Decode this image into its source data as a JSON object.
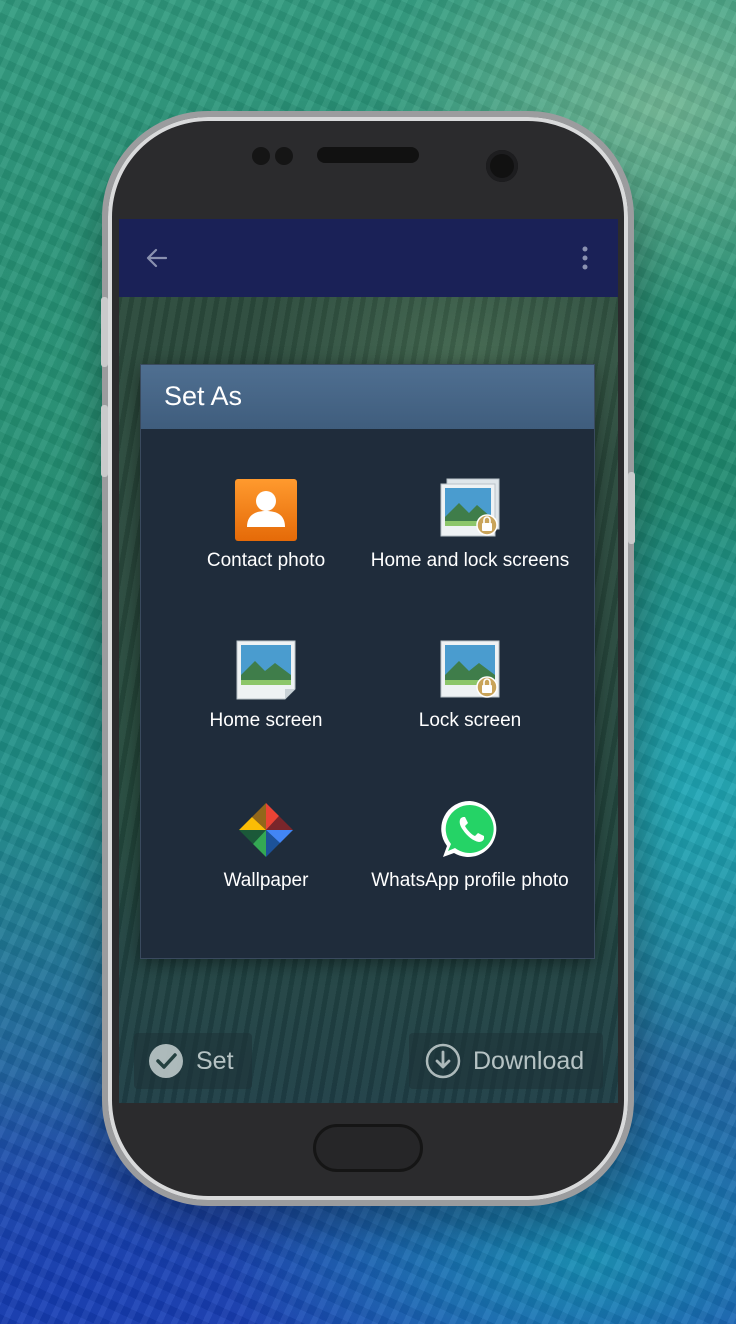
{
  "appbar": {
    "back_icon": "arrow-back-icon",
    "menu_icon": "more-vert-icon"
  },
  "dialog": {
    "title": "Set As",
    "options": [
      {
        "label": "Contact photo",
        "icon": "contact-icon"
      },
      {
        "label": "Home and lock screens",
        "icon": "home-lock-screens-icon"
      },
      {
        "label": "Home screen",
        "icon": "home-screen-icon"
      },
      {
        "label": "Lock screen",
        "icon": "lock-screen-icon"
      },
      {
        "label": "Wallpaper",
        "icon": "pinwheel-icon"
      },
      {
        "label": "WhatsApp profile photo",
        "icon": "whatsapp-icon"
      }
    ]
  },
  "bottom": {
    "set_label": "Set",
    "download_label": "Download"
  },
  "colors": {
    "appbar": "#1a2157",
    "dialog_header": "#4f6f91",
    "dialog_body": "#1f2c3b",
    "contact_orange": "#f07a12",
    "whatsapp_green": "#25d366"
  }
}
